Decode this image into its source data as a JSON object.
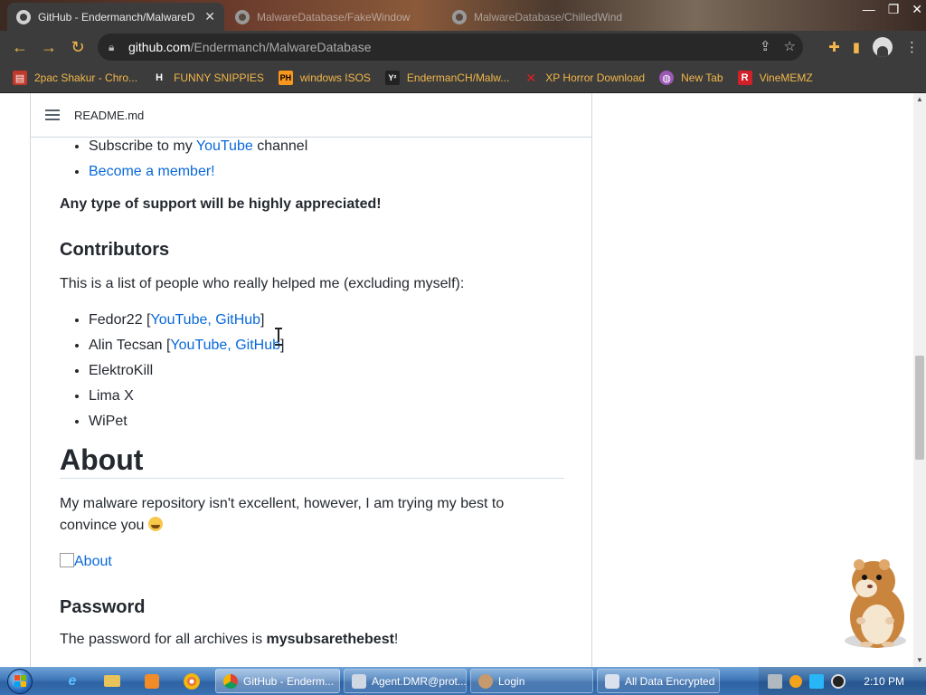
{
  "browser": {
    "tabs": [
      {
        "title": "GitHub - Endermanch/MalwareD",
        "active": true,
        "icon": "github-icon"
      },
      {
        "title": "MalwareDatabase/FakeWindow",
        "active": false,
        "icon": "github-icon"
      },
      {
        "title": "MalwareDatabase/ChilledWind",
        "active": false,
        "icon": "github-icon"
      }
    ],
    "url": {
      "host": "github.com",
      "path": "/Endermanch/MalwareDatabase"
    },
    "bookmarks": [
      {
        "label": "2pac Shakur - Chro...",
        "icon": "folder-icon",
        "color": "#c0392b"
      },
      {
        "label": "FUNNY SNIPPIES",
        "icon": "h-logo-icon",
        "color": "#ffffff"
      },
      {
        "label": "windows ISOS",
        "icon": "ph-logo-icon",
        "color": "#f7971d"
      },
      {
        "label": "EndermanCH/Malw...",
        "icon": "yp-logo-icon",
        "color": "#222222"
      },
      {
        "label": "XP Horror Download",
        "icon": "x-icon",
        "color": "#e02020"
      },
      {
        "label": "New Tab",
        "icon": "globe-icon",
        "color": "#9b59b6"
      },
      {
        "label": "VineMEMZ",
        "icon": "r-logo-icon",
        "color": "#d0202a"
      }
    ]
  },
  "readme": {
    "filename": "README.md",
    "support_items": [
      {
        "prefix": "Subscribe to my ",
        "link": "YouTube",
        "suffix": " channel"
      },
      {
        "prefix": "",
        "link": "Become a member!",
        "suffix": ""
      }
    ],
    "support_note": "Any type of support will be highly appreciated!",
    "contributors_heading": "Contributors",
    "contributors_intro": "This is a list of people who really helped me (excluding myself):",
    "contributors": [
      {
        "name": "Fedor22",
        "links": "YouTube, GitHub"
      },
      {
        "name": "Alin Tecsan",
        "links": "YouTube, GitHub"
      },
      {
        "name": "ElektroKill",
        "links": ""
      },
      {
        "name": "Lima X",
        "links": ""
      },
      {
        "name": "WiPet",
        "links": ""
      }
    ],
    "about_heading": "About",
    "about_text": "My malware repository isn't excellent, however, I am trying my best to convince you",
    "about_image_alt": "About",
    "password_heading": "Password",
    "password_text": "The password for all archives is ",
    "password_value": "mysubsarethebest",
    "password_end": "!"
  },
  "taskbar": {
    "items": [
      {
        "label": "GitHub - Enderm...",
        "icon": "chrome-icon",
        "active": true
      },
      {
        "label": "Agent.DMR@prot...",
        "icon": "program-icon",
        "active": false
      },
      {
        "label": "Login",
        "icon": "login-icon",
        "active": false
      },
      {
        "label": "All Data Encrypted",
        "icon": "window-icon",
        "active": false
      }
    ],
    "clock": "2:10 PM"
  },
  "colors": {
    "link": "#0969da",
    "bookmark_text": "#f2b74a",
    "toolbar": "#3c3c3c"
  }
}
